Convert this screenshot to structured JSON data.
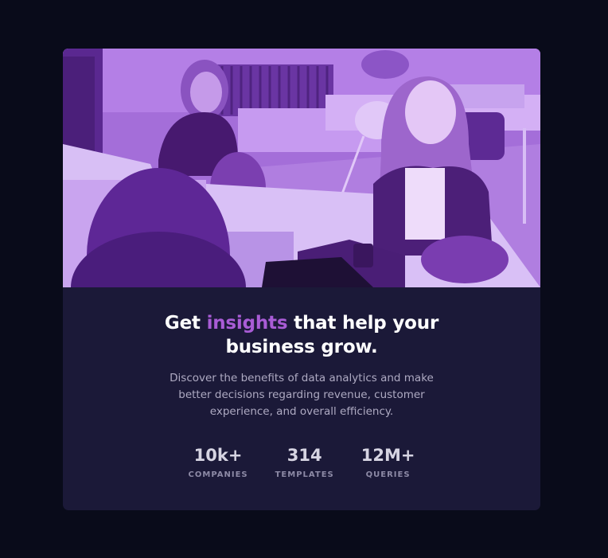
{
  "hero_image": {
    "icon": "office-team-photo"
  },
  "headline": {
    "before": "Get ",
    "accent": "insights",
    "after": " that help your business grow."
  },
  "description": "Discover the benefits of data analytics and make better decisions regarding revenue, customer experience, and overall efficiency.",
  "stats": [
    {
      "value": "10k+",
      "label": "COMPANIES"
    },
    {
      "value": "314",
      "label": "TEMPLATES"
    },
    {
      "value": "12M+",
      "label": "QUERIES"
    }
  ],
  "colors": {
    "background": "#090b1a",
    "card": "#1b1938",
    "accent": "#a95cd6",
    "photo_tint": "#9b60d6"
  }
}
